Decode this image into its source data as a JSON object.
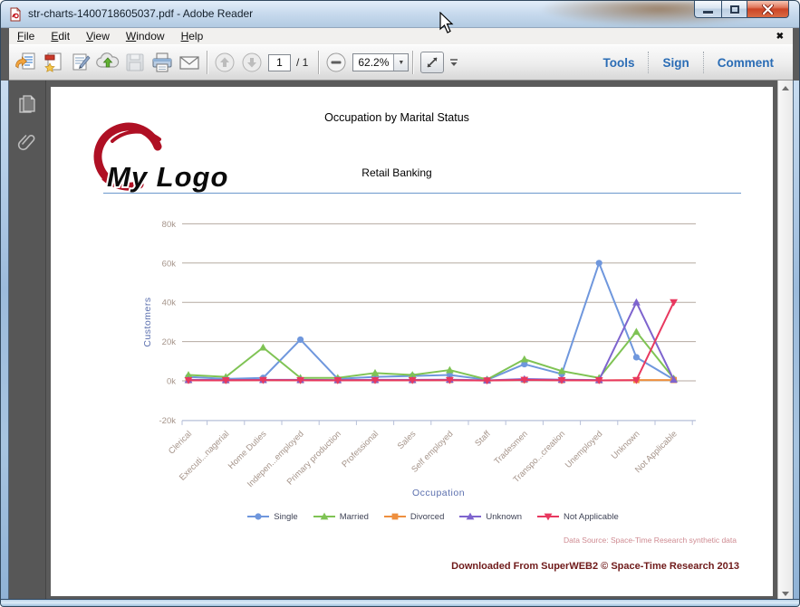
{
  "window": {
    "title": "str-charts-1400718605037.pdf - Adobe Reader",
    "caption_icons": [
      "minimize-icon",
      "restore-icon",
      "close-icon"
    ]
  },
  "menu": {
    "items": [
      {
        "key": "F",
        "rest": "ile"
      },
      {
        "key": "E",
        "rest": "dit"
      },
      {
        "key": "V",
        "rest": "iew"
      },
      {
        "key": "W",
        "rest": "indow"
      },
      {
        "key": "H",
        "rest": "elp"
      }
    ],
    "close_glyph": "✖"
  },
  "toolbar": {
    "icon_names": [
      "open-icon",
      "create-pdf-icon",
      "sign-fill-icon",
      "cloud-upload-icon",
      "save-icon",
      "print-icon",
      "email-icon",
      "previous-page-icon",
      "next-page-icon",
      "zoom-out-icon",
      "fit-window-icon",
      "toolbar-overflow-icon"
    ],
    "page_value": "1",
    "page_total": "/ 1",
    "zoom_value": "62.2%",
    "zoom_caret": "▼",
    "links": [
      "Tools",
      "Sign",
      "Comment"
    ]
  },
  "sidebar": {
    "icon_names": [
      "page-thumbnails-icon",
      "attachments-icon"
    ]
  },
  "document": {
    "logo_text": "My Logo",
    "footer": "Downloaded From SuperWEB2 © Space-Time Research 2013"
  },
  "chart_data": {
    "type": "line",
    "title": "Occupation by Marital Status",
    "subtitle": "Retail Banking",
    "xlabel": "Occupation",
    "ylabel": "Customers",
    "ylim": [
      -20000,
      80000
    ],
    "yticks": [
      80000,
      60000,
      40000,
      20000,
      0,
      -20000
    ],
    "ytick_labels": [
      "80k",
      "60k",
      "40k",
      "20k",
      "0k",
      "-20k"
    ],
    "grid": true,
    "legend_position": "bottom",
    "annotations": [
      "Data Source: Space-Time Research synthetic data"
    ],
    "categories": [
      "Clerical",
      "Executi...nagerial",
      "Home Duties",
      "Indepen...employed",
      "Primary production",
      "Professional",
      "Sales",
      "Self employed",
      "Staff",
      "Tradesmen",
      "Transpo...creation",
      "Unemployed",
      "Unknown",
      "Not Applicable"
    ],
    "series": [
      {
        "name": "Single",
        "color": "#6f97dd",
        "marker": "circle",
        "values": [
          2000,
          1000,
          1500,
          21000,
          1000,
          2000,
          2500,
          3000,
          500,
          8500,
          3500,
          60000,
          12000,
          700
        ]
      },
      {
        "name": "Married",
        "color": "#7fc354",
        "marker": "triangle-up",
        "values": [
          3000,
          2000,
          17000,
          1500,
          1500,
          4000,
          3000,
          5500,
          700,
          11000,
          5000,
          1500,
          25000,
          1200
        ]
      },
      {
        "name": "Divorced",
        "color": "#ee8f3e",
        "marker": "square",
        "values": [
          300,
          250,
          400,
          350,
          250,
          350,
          350,
          400,
          150,
          500,
          350,
          250,
          400,
          400
        ]
      },
      {
        "name": "Unknown",
        "color": "#7e64ce",
        "marker": "triangle-up",
        "values": [
          500,
          400,
          500,
          500,
          400,
          500,
          500,
          600,
          250,
          900,
          600,
          400,
          40000,
          600
        ]
      },
      {
        "name": "Not Applicable",
        "color": "#e8385f",
        "marker": "triangle-down",
        "values": [
          300,
          250,
          350,
          300,
          250,
          300,
          300,
          350,
          150,
          450,
          300,
          250,
          350,
          40000
        ]
      }
    ],
    "colors": {
      "gridline": "#b5aaa1",
      "tick_label": "#a5948a",
      "axis_title": "#5b6fae",
      "axis_line": "#b6bfd9"
    }
  }
}
